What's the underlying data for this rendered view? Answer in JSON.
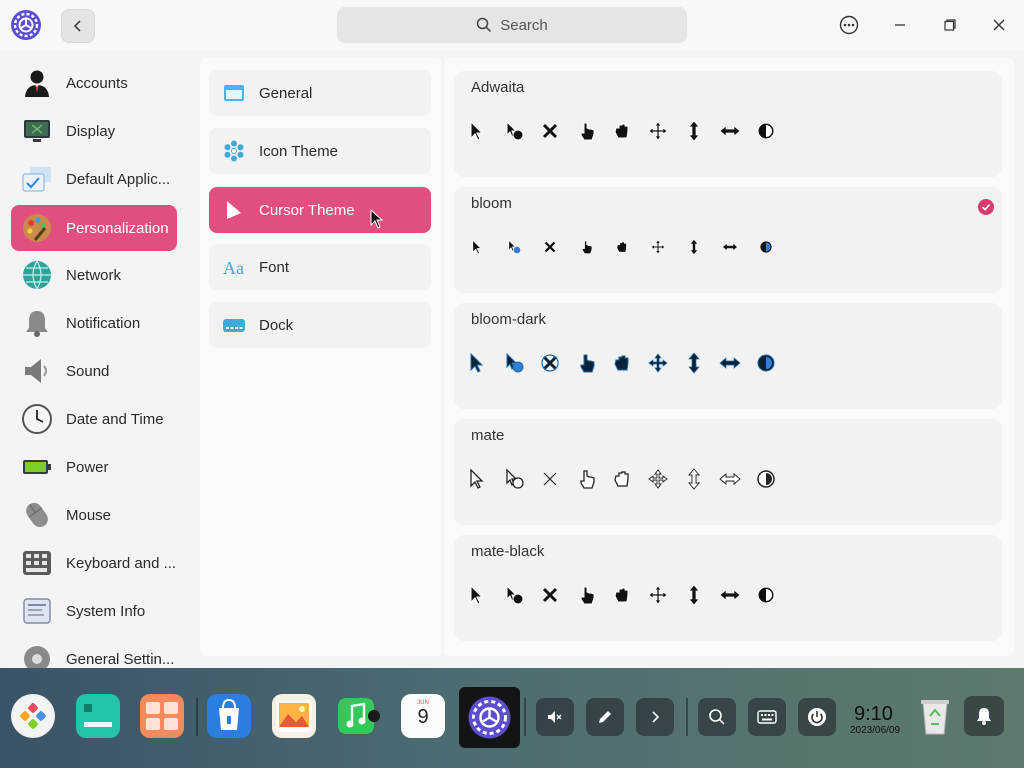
{
  "titlebar": {
    "search_placeholder": "Search"
  },
  "sidebar": {
    "items": [
      {
        "label": "Accounts",
        "icon": "accounts-icon"
      },
      {
        "label": "Display",
        "icon": "display-icon"
      },
      {
        "label": "Default Applic...",
        "icon": "default-apps-icon"
      },
      {
        "label": "Personalization",
        "icon": "personalization-icon",
        "active": true
      },
      {
        "label": "Network",
        "icon": "network-icon"
      },
      {
        "label": "Notification",
        "icon": "bell-icon"
      },
      {
        "label": "Sound",
        "icon": "speaker-icon"
      },
      {
        "label": "Date and Time",
        "icon": "clock-icon"
      },
      {
        "label": "Power",
        "icon": "battery-icon"
      },
      {
        "label": "Mouse",
        "icon": "mouse-icon"
      },
      {
        "label": "Keyboard and ...",
        "icon": "keyboard-icon"
      },
      {
        "label": "System Info",
        "icon": "system-info-icon"
      },
      {
        "label": "General Settin...",
        "icon": "general-settings-icon"
      }
    ]
  },
  "middle": {
    "items": [
      {
        "label": "General",
        "icon": "window-icon"
      },
      {
        "label": "Icon Theme",
        "icon": "snowflake-icon"
      },
      {
        "label": "Cursor Theme",
        "icon": "cursor-icon",
        "active": true
      },
      {
        "label": "Font",
        "icon": "font-icon"
      },
      {
        "label": "Dock",
        "icon": "dock-icon"
      }
    ]
  },
  "themes": [
    {
      "name": "Adwaita",
      "style": "adwaita",
      "selected": false
    },
    {
      "name": "bloom",
      "style": "bloom",
      "selected": true
    },
    {
      "name": "bloom-dark",
      "style": "bloomdark",
      "selected": false
    },
    {
      "name": "mate",
      "style": "mate",
      "selected": false
    },
    {
      "name": "mate-black",
      "style": "mateblack",
      "selected": false
    }
  ],
  "dock": {
    "time": "9:10",
    "date": "2023/06/09",
    "calendar_month": "JUN",
    "calendar_day": "9"
  },
  "colors": {
    "accent": "#e04f7f",
    "check": "#d93b6f"
  }
}
